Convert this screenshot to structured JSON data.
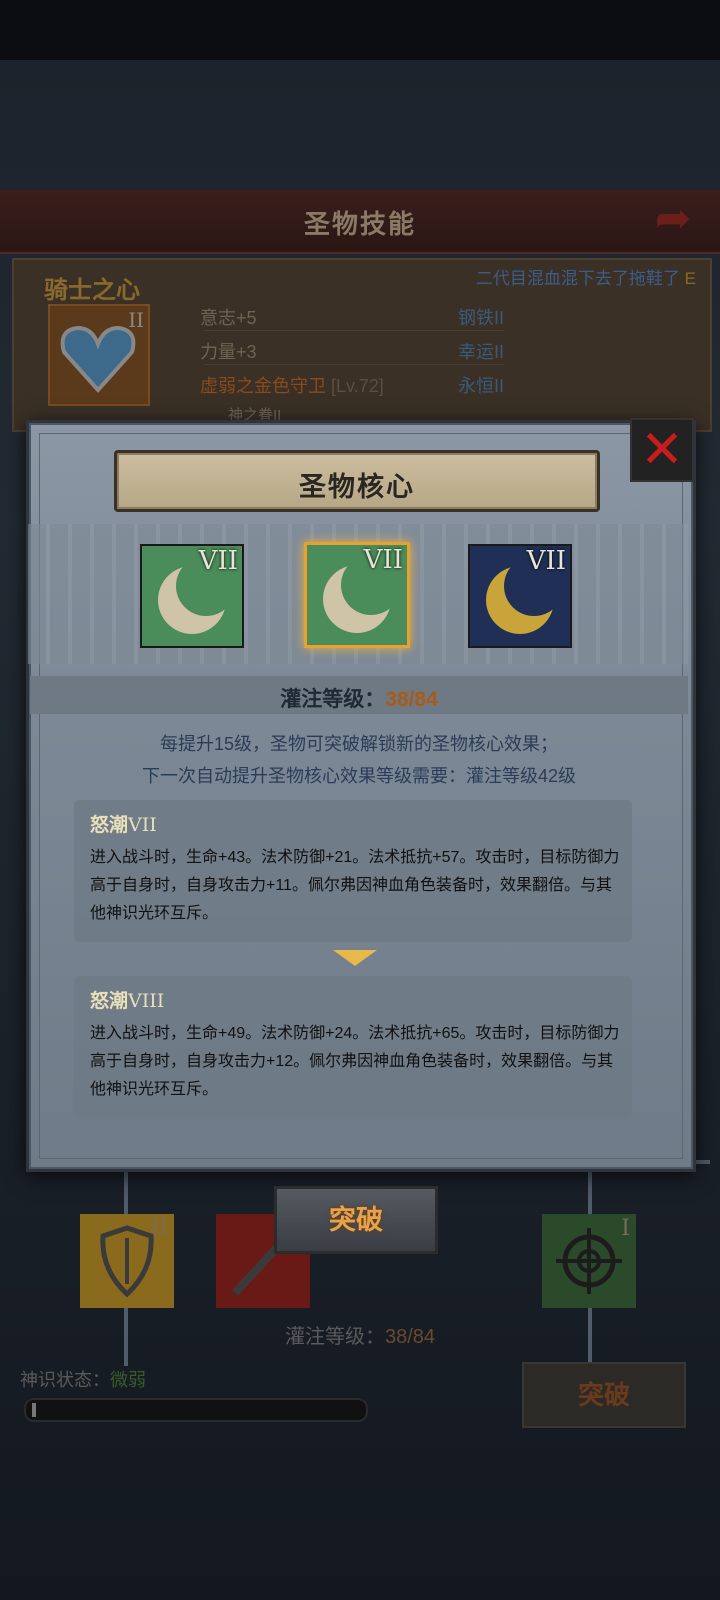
{
  "header": {
    "title": "圣物技能"
  },
  "relic": {
    "name": "骑士之心",
    "level_roman": "II",
    "owner": "二代目混血混下去了拖鞋了",
    "owner_suffix": "E",
    "stats": {
      "left": [
        "意志+5",
        "力量+3",
        "虚弱之金色守卫",
        "神之眷II"
      ],
      "guard_level": "[Lv.72]",
      "right": [
        "钢铁II",
        "幸运II",
        "永恒II"
      ]
    }
  },
  "modal": {
    "title": "圣物核心",
    "cores": [
      {
        "name": "core-1",
        "roman": "VII",
        "color": "#4a8c5a",
        "moon": "#cfc3a8",
        "selected": false
      },
      {
        "name": "core-2",
        "roman": "VII",
        "color": "#4a8c5a",
        "moon": "#cfc3a8",
        "selected": true
      },
      {
        "name": "core-3",
        "roman": "VII",
        "color": "#1f2f55",
        "moon": "#c8a43a",
        "selected": false
      }
    ],
    "infuse_label": "灌注等级：",
    "infuse_value": "38/84",
    "desc_line1": "每提升15级，圣物可突破解锁新的圣物核心效果；",
    "desc_line2": "下一次自动提升圣物核心效果等级需要：灌注等级42级",
    "current_effect": {
      "name": "怒潮",
      "roman": "VII",
      "text": "进入战斗时，生命+43。法术防御+21。法术抵抗+57。攻击时，目标防御力高于自身时，自身攻击力+11。佩尔弗因神血角色装备时，效果翻倍。与其他神识光环互斥。"
    },
    "next_effect": {
      "name": "怒潮",
      "roman": "VIII",
      "text": "进入战斗时，生命+49。法术防御+24。法术抵抗+65。攻击时，目标防御力高于自身时，自身攻击力+12。佩尔弗因神血角色装备时，效果翻倍。与其他神识光环互斥。"
    },
    "break_button": "突破"
  },
  "background": {
    "skills": [
      {
        "name": "shield",
        "roman": "II",
        "color": "#8a6a1c"
      },
      {
        "name": "sword",
        "roman": "",
        "color": "#6a1a16"
      },
      {
        "name": "target",
        "roman": "I",
        "color": "#2a4a2a"
      }
    ],
    "infuse_label": "灌注等级：",
    "infuse_value": "38/84",
    "status_label": "神识状态：",
    "status_value": "微弱",
    "status_progress": 0.02,
    "break_button": "突破"
  },
  "colors": {
    "accent": "#e8a24a",
    "close": "#c81d1d",
    "infuse_value": "#a85a18"
  }
}
